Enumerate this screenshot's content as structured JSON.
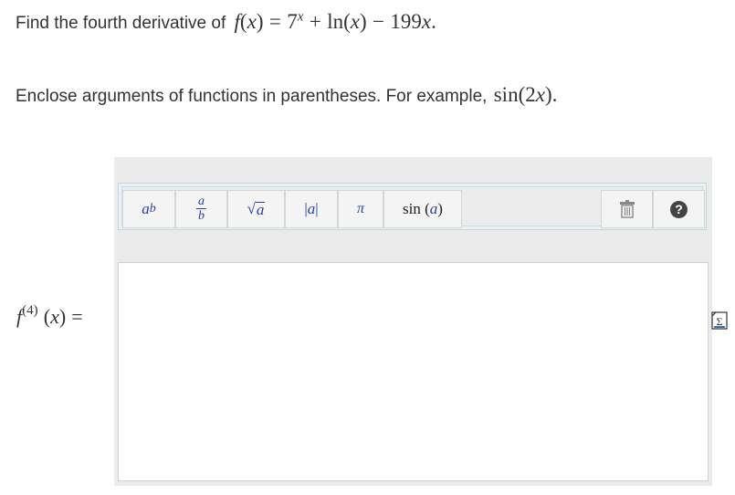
{
  "question": {
    "prefix": "Find the fourth derivative of",
    "fn": "f",
    "var": "x",
    "eq": "=",
    "base": "7",
    "exp": "x",
    "plus": "+",
    "ln": "ln",
    "minus": "−",
    "coef": "199",
    "end": "."
  },
  "hint": {
    "text": "Enclose arguments of functions in parentheses. For example,",
    "fn": "sin",
    "arg_num": "2",
    "arg_var": "x",
    "end": "."
  },
  "toolbar": {
    "power": {
      "base": "a",
      "exp": "b"
    },
    "fraction": {
      "num": "a",
      "den": "b"
    },
    "sqrt": {
      "sym": "√",
      "arg": "a"
    },
    "abs": {
      "open": "|",
      "arg": "a",
      "close": "|"
    },
    "pi": "π",
    "sin": {
      "fn": "sin",
      "arg": "a"
    },
    "trash_icon": "trash-icon",
    "help_icon": "help-icon",
    "help_glyph": "?"
  },
  "answer": {
    "fn": "f",
    "order": "(4)",
    "var": "x",
    "eq": "=",
    "value": ""
  },
  "colors": {
    "toolbar_symbol": "#2b3da8",
    "panel_bg": "#ebebeb",
    "help_circle": "#444444"
  }
}
